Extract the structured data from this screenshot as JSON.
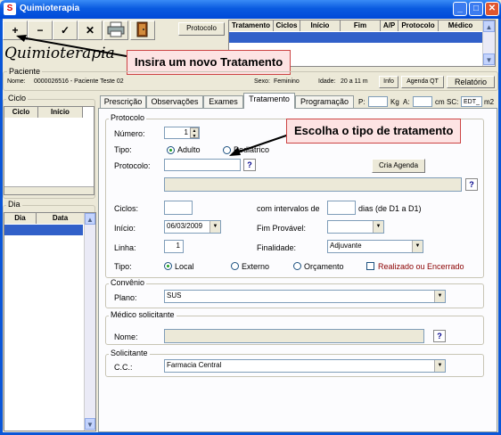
{
  "window": {
    "title": "Quimioterapia",
    "min": "_",
    "max": "□",
    "close": "✕"
  },
  "toolbar": {
    "add": "+",
    "remove": "−",
    "confirm": "✓",
    "cancel": "✕",
    "protocol_button": "Protocolo"
  },
  "top_grid": {
    "columns": [
      "Tratamento",
      "Ciclos",
      "Início",
      "Fim",
      "A/P",
      "Protocolo",
      "Médico"
    ]
  },
  "app_title": "Quimioterapia",
  "callouts": {
    "new_treatment": "Insira um novo Tratamento",
    "choose_type": "Escolha o tipo de tratamento"
  },
  "patient": {
    "label": "Paciente",
    "name_label": "Nome:",
    "name_value": "0000026516 - Paciente Teste 02",
    "sex_label": "Sexo:",
    "sex_value": "Feminino",
    "age_label": "Idade:",
    "age_value": "20 a 11 m",
    "info_button": "Info",
    "agenda_button": "Agenda QT",
    "report_button": "Relatório"
  },
  "cycle": {
    "label": "Ciclo",
    "columns": [
      "Ciclo",
      "Início"
    ]
  },
  "day": {
    "label": "Dia",
    "columns": [
      "Dia",
      "Data"
    ]
  },
  "tabs": [
    "Prescrição",
    "Observações",
    "Exames",
    "Tratamento",
    "Programação"
  ],
  "metrics": {
    "p_label": "P:",
    "kg_label": "Kg",
    "a_label": "A:",
    "cm_label": "cm",
    "sc_label": "SC:",
    "sc_value": "EDT_",
    "m2_label": "m2"
  },
  "protocol": {
    "legend": "Protocolo",
    "number_label": "Número:",
    "number_value": "1",
    "type_label": "Tipo:",
    "type_adult": "Adulto",
    "type_pediatric": "Pediátrico",
    "protocol_label": "Protocolo:",
    "create_agenda": "Cria Agenda",
    "cycles_label": "Ciclos:",
    "interval_label": "com intervalos de",
    "days_label": "dias (de D1 a D1)",
    "start_label": "Início:",
    "start_value": "06/03/2009",
    "end_label": "Fim Provável:",
    "line_label": "Linha:",
    "line_value": "1",
    "purpose_label": "Finalidade:",
    "purpose_value": "Adjuvante",
    "place_label": "Tipo:",
    "place_local": "Local",
    "place_external": "Externo",
    "place_budget": "Orçamento",
    "done_label": "Realizado ou Encerrado"
  },
  "convenio": {
    "legend": "Convênio",
    "plan_label": "Plano:",
    "plan_value": "SUS"
  },
  "doctor": {
    "legend": "Médico solicitante",
    "name_label": "Nome:"
  },
  "requester": {
    "legend": "Solicitante",
    "cc_label": "C.C.:",
    "cc_value": "Farmacia Central"
  },
  "icons": {
    "question": "?",
    "dropdown": "▼",
    "spin_up": "▲",
    "spin_down": "▼",
    "scroll_up": "▲",
    "scroll_down": "▼"
  },
  "colors": {
    "titlebar": "#0a5be0",
    "callout_bg": "#fde3e3",
    "selected_row": "#3160c9",
    "done_text": "#8b0000"
  }
}
